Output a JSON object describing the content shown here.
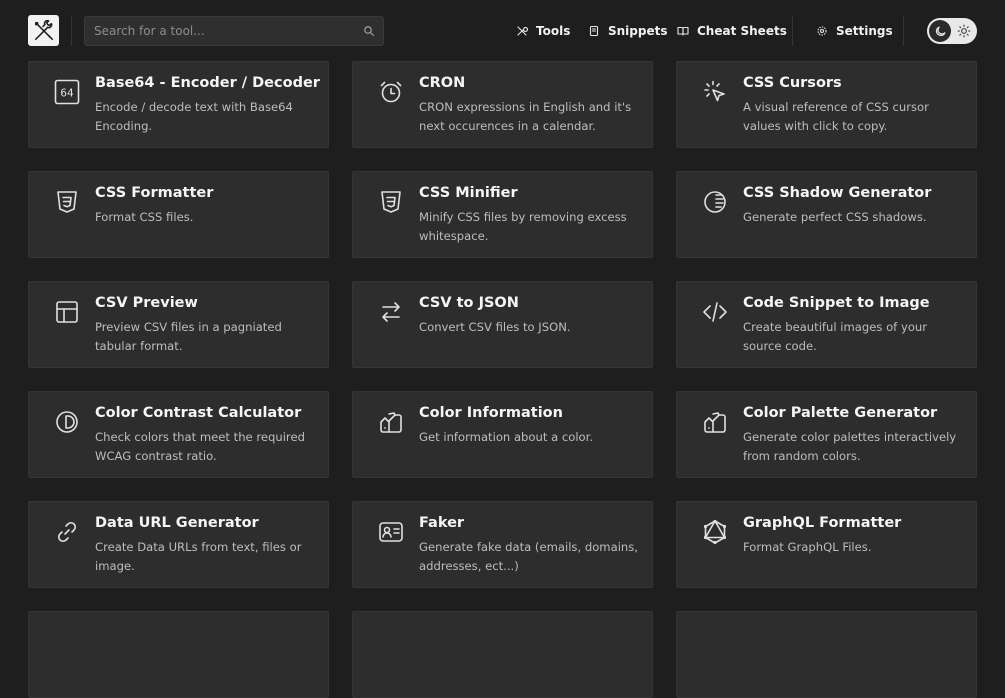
{
  "search": {
    "placeholder": "Search for a tool..."
  },
  "nav": {
    "tools": "Tools",
    "snippets": "Snippets",
    "cheat_sheets": "Cheat Sheets",
    "settings": "Settings"
  },
  "theme": {
    "mode": "dark"
  },
  "tools": [
    {
      "title": "Base64 - Encoder / Decoder",
      "description": "Encode / decode text with Base64 Encoding.",
      "icon": "base64-icon",
      "icon_text": "64"
    },
    {
      "title": "CRON",
      "description": "CRON expressions in English and it's next occurences in a calendar.",
      "icon": "alarm-clock-icon"
    },
    {
      "title": "CSS Cursors",
      "description": "A visual reference of CSS cursor values with click to copy.",
      "icon": "cursor-click-icon"
    },
    {
      "title": "CSS Formatter",
      "description": "Format CSS files.",
      "icon": "css3-icon"
    },
    {
      "title": "CSS Minifier",
      "description": "Minify CSS files by removing excess whitespace.",
      "icon": "css3-icon"
    },
    {
      "title": "CSS Shadow Generator",
      "description": "Generate perfect CSS shadows.",
      "icon": "shadow-icon"
    },
    {
      "title": "CSV Preview",
      "description": "Preview CSV files in a pagniated tabular format.",
      "icon": "table-icon"
    },
    {
      "title": "CSV to JSON",
      "description": "Convert CSV files to JSON.",
      "icon": "transfer-icon"
    },
    {
      "title": "Code Snippet to Image",
      "description": "Create beautiful images of your source code.",
      "icon": "code-icon"
    },
    {
      "title": "Color Contrast Calculator",
      "description": "Check colors that meet the required WCAG contrast ratio.",
      "icon": "contrast-icon"
    },
    {
      "title": "Color Information",
      "description": "Get information about a color.",
      "icon": "color-swatch-icon"
    },
    {
      "title": "Color Palette Generator",
      "description": "Generate color palettes interactively from random colors.",
      "icon": "color-swatch-icon"
    },
    {
      "title": "Data URL Generator",
      "description": "Create Data URLs from text, files or image.",
      "icon": "link-icon"
    },
    {
      "title": "Faker",
      "description": "Generate fake data (emails, domains, addresses, ect...)",
      "icon": "id-card-icon"
    },
    {
      "title": "GraphQL Formatter",
      "description": "Format GraphQL Files.",
      "icon": "graphql-icon"
    },
    {
      "title": "",
      "description": "",
      "icon": ""
    },
    {
      "title": "",
      "description": "",
      "icon": ""
    },
    {
      "title": "",
      "description": "",
      "icon": ""
    }
  ]
}
